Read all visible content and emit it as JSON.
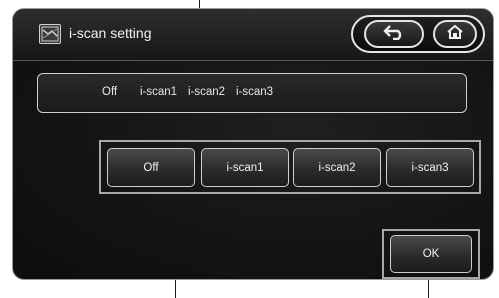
{
  "header": {
    "title": "i-scan setting",
    "title_icon": "i-scan-settings-icon",
    "back_icon": "back-arrow-icon",
    "home_icon": "home-icon"
  },
  "status": {
    "items": [
      "Off",
      "i-scan1",
      "i-scan2",
      "i-scan3"
    ]
  },
  "modes": {
    "buttons": [
      "Off",
      "i-scan1",
      "i-scan2",
      "i-scan3"
    ]
  },
  "footer": {
    "ok_label": "OK"
  },
  "colors": {
    "background": "#141414",
    "border": "#cfcfcf",
    "text": "#f0f0f0"
  }
}
